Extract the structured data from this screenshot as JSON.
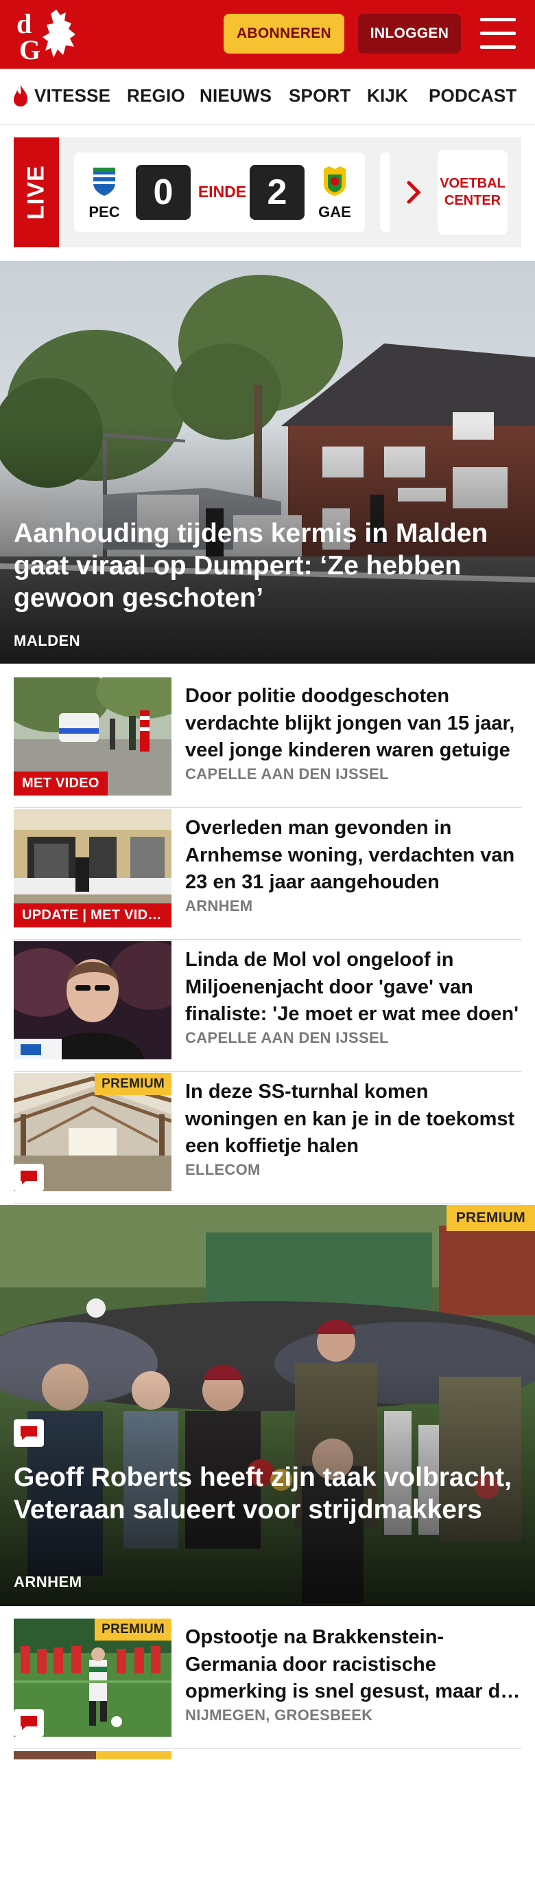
{
  "header": {
    "subscribe_label": "ABONNEREN",
    "login_label": "INLOGGEN",
    "brand_color": "#d10a10"
  },
  "nav": {
    "items": [
      "VITESSE",
      "REGIO",
      "NIEUWS",
      "SPORT",
      "KIJK",
      "PODCAST"
    ]
  },
  "live": {
    "label": "LIVE",
    "home": {
      "name": "PEC",
      "score": "0"
    },
    "away": {
      "name": "GAE",
      "score": "2"
    },
    "status": "EINDE",
    "voetbal_center": "VOETBAL CENTER"
  },
  "hero1": {
    "title": "Aanhouding tijdens kermis in Malden gaat viraal op Dumpert: ‘Ze hebben gewoon geschoten’",
    "location": "MALDEN"
  },
  "list1": [
    {
      "title": "Door politie doodgeschoten verdachte blijkt jongen van 15 jaar, veel jonge kinderen waren getuige",
      "location": "CAPELLE AAN DEN IJSSEL",
      "badge": "MET VIDEO"
    },
    {
      "title": "Overleden man gevonden in Arnhemse woning, verdachten van 23 en 31 jaar aangehouden",
      "location": "ARNHEM",
      "badge": "UPDATE | MET VIDEO"
    },
    {
      "title": "Linda de Mol vol ongeloof in Miljoenenjacht door 'gave' van finaliste: 'Je moet er wat mee doen'",
      "location": "CAPELLE AAN DEN IJSSEL"
    },
    {
      "title": "In deze SS-turnhal komen woningen en kan je in de toekomst een koffietje halen",
      "location": "ELLECOM",
      "badge": "PREMIUM"
    }
  ],
  "hero2": {
    "title": "Geoff Roberts heeft zijn taak volbracht, Veteraan salueert voor strijdmakkers",
    "location": "ARNHEM",
    "badge": "PREMIUM"
  },
  "list2": [
    {
      "title": "Opstootje na Brakkenstein-Germania door racistische opmerking is snel gesust, maar de nasleep duurt voort",
      "location": "NIJMEGEN, GROESBEEK",
      "badge": "PREMIUM"
    }
  ],
  "icons": {
    "menu": "hamburger-icon",
    "flame": "flame-icon",
    "comment": "comment-icon",
    "chevron": "chevron-right-icon"
  }
}
